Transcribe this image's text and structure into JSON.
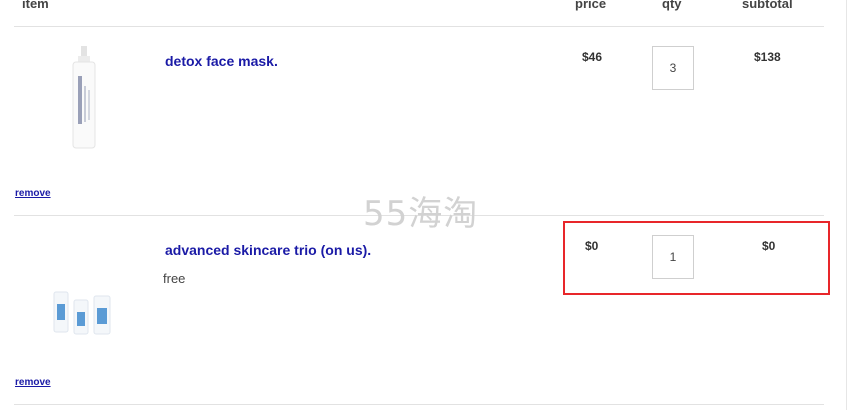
{
  "header": {
    "item": "item",
    "price": "price",
    "qty": "qty",
    "subtotal": "subtotal"
  },
  "items": [
    {
      "name": "detox face mask.",
      "note": "",
      "price": "$46",
      "qty": "3",
      "subtotal": "$138",
      "remove": "remove"
    },
    {
      "name": "advanced skincare trio (on us).",
      "note": "free",
      "price": "$0",
      "qty": "1",
      "subtotal": "$0",
      "remove": "remove"
    }
  ],
  "brand_on_bottle": "MALIN+GOETZ",
  "watermark": "55海淘",
  "colors": {
    "link": "#1a1aa6",
    "highlight": "#e8262a"
  }
}
